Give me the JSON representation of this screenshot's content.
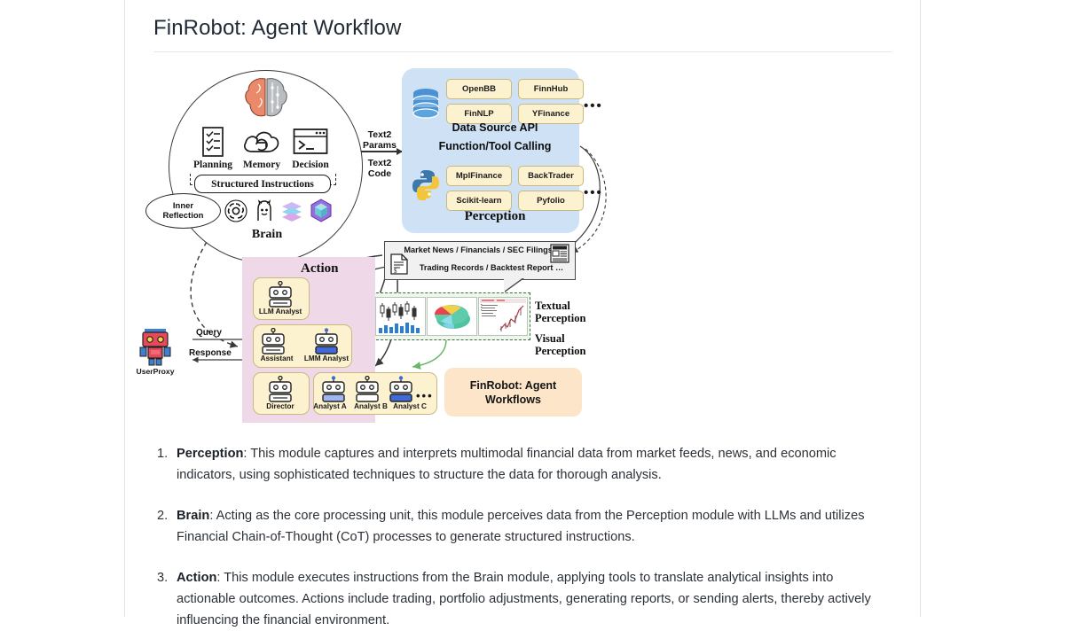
{
  "page": {
    "title": "FinRobot: Agent Workflow"
  },
  "figure": {
    "brain": {
      "modules": [
        {
          "label": "Planning",
          "icon": "checklist-icon"
        },
        {
          "label": "Memory",
          "icon": "cloud-refresh-icon"
        },
        {
          "label": "Decision",
          "icon": "terminal-window-icon"
        }
      ],
      "structured_instructions": "Structured Instructions",
      "inner_reflection_line1": "Inner",
      "inner_reflection_line2": "Reflection",
      "caption": "Brain",
      "llm_logos": [
        "openai-logo-icon",
        "llama-logo-icon",
        "layers-logo-icon",
        "gem-hexagon-logo-icon"
      ]
    },
    "bridges": {
      "text2params_line1": "Text2",
      "text2params_line2": "Params",
      "text2code_line1": "Text2",
      "text2code_line2": "Code"
    },
    "perception": {
      "data_source_api": {
        "caption": "Data Source API",
        "chips": [
          "OpenBB",
          "FinnHub",
          "FinNLP",
          "YFinance"
        ],
        "ellipsis": "•••",
        "icon": "database-icon"
      },
      "function_tool_calling": {
        "caption": "Function/Tool Calling",
        "chips": [
          "MplFinance",
          "BackTrader",
          "Scikit-learn",
          "Pyfolio"
        ],
        "ellipsis": "•••",
        "icon": "python-logo-icon"
      },
      "caption": "Perception"
    },
    "textual_box": {
      "line1": "Market News / Financials / SEC Filings …",
      "line2": "Trading Records / Backtest Report …",
      "doc_icon": "document-icon",
      "news_icon": "newspaper-icon"
    },
    "labels": {
      "textual_perception_l1": "Textual",
      "textual_perception_l2": "Perception",
      "visual_perception_l1": "Visual",
      "visual_perception_l2": "Perception"
    },
    "visual_strip": {
      "charts": [
        "candlestick-chart-icon",
        "pie-chart-icon",
        "stock-screen-icon"
      ]
    },
    "action": {
      "title": "Action",
      "agents": [
        {
          "label": "LLM Analyst",
          "icon": "robot-icon"
        },
        {
          "label": "Assistant",
          "icon": "robot-icon"
        },
        {
          "label": "LMM Analyst",
          "icon": "robot-blue-icon"
        },
        {
          "label": "Director",
          "icon": "robot-icon"
        },
        {
          "label": "Analyst A",
          "icon": "robot-blue-icon"
        },
        {
          "label": "Analyst B",
          "icon": "robot-icon"
        },
        {
          "label": "Analyst C",
          "icon": "robot-blue-icon"
        }
      ],
      "row_ellipsis": "•••"
    },
    "workflow_box": {
      "line1": "FinRobot: Agent",
      "line2": "Workflows"
    },
    "user": {
      "label": "UserProxy",
      "query": "Query",
      "response": "Response",
      "icon": "user-robot-icon"
    },
    "colors": {
      "perception_panel": "#cfe2f5",
      "action_panel": "#efd8e8",
      "chip": "#fdf2cf",
      "workflow_box": "#fce5c8",
      "visual_strip": "#eef6ee"
    }
  },
  "list": [
    {
      "term": "Perception",
      "text": ": This module captures and interprets multimodal financial data from market feeds, news, and economic indicators, using sophisticated techniques to structure the data for thorough analysis."
    },
    {
      "term": "Brain",
      "text": ": Acting as the core processing unit, this module perceives data from the Perception module with LLMs and utilizes Financial Chain-of-Thought (CoT) processes to generate structured instructions."
    },
    {
      "term": "Action",
      "text": ": This module executes instructions from the Brain module, applying tools to translate analytical insights into actionable outcomes. Actions include trading, portfolio adjustments, generating reports, or sending alerts, thereby actively influencing the financial environment."
    }
  ]
}
